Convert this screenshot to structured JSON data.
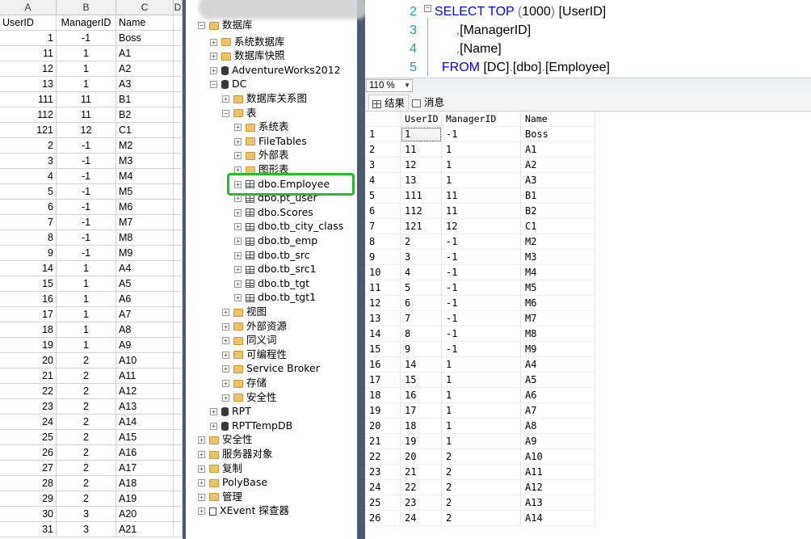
{
  "excel": {
    "col_headers": [
      "A",
      "B",
      "C",
      "D"
    ],
    "header_row": [
      "UserID",
      "ManagerID",
      "Name"
    ],
    "rows": [
      [
        "1",
        "-1",
        "Boss"
      ],
      [
        "11",
        "1",
        "A1"
      ],
      [
        "12",
        "1",
        "A2"
      ],
      [
        "13",
        "1",
        "A3"
      ],
      [
        "111",
        "11",
        "B1"
      ],
      [
        "112",
        "11",
        "B2"
      ],
      [
        "121",
        "12",
        "C1"
      ],
      [
        "2",
        "-1",
        "M2"
      ],
      [
        "3",
        "-1",
        "M3"
      ],
      [
        "4",
        "-1",
        "M4"
      ],
      [
        "5",
        "-1",
        "M5"
      ],
      [
        "6",
        "-1",
        "M6"
      ],
      [
        "7",
        "-1",
        "M7"
      ],
      [
        "8",
        "-1",
        "M8"
      ],
      [
        "9",
        "-1",
        "M9"
      ],
      [
        "14",
        "1",
        "A4"
      ],
      [
        "15",
        "1",
        "A5"
      ],
      [
        "16",
        "1",
        "A6"
      ],
      [
        "17",
        "1",
        "A7"
      ],
      [
        "18",
        "1",
        "A8"
      ],
      [
        "19",
        "1",
        "A9"
      ],
      [
        "20",
        "2",
        "A10"
      ],
      [
        "21",
        "2",
        "A11"
      ],
      [
        "22",
        "2",
        "A12"
      ],
      [
        "23",
        "2",
        "A13"
      ],
      [
        "24",
        "2",
        "A14"
      ],
      [
        "25",
        "2",
        "A15"
      ],
      [
        "26",
        "2",
        "A16"
      ],
      [
        "27",
        "2",
        "A17"
      ],
      [
        "28",
        "2",
        "A18"
      ],
      [
        "29",
        "2",
        "A19"
      ],
      [
        "30",
        "3",
        "A20"
      ],
      [
        "31",
        "3",
        "A21"
      ]
    ]
  },
  "explorer": {
    "nodes": [
      {
        "label": "数据库",
        "icon": "folder",
        "indent": 0,
        "exp": "-",
        "partial": true
      },
      {
        "label": "系统数据库",
        "icon": "folder",
        "indent": 1,
        "exp": "+"
      },
      {
        "label": "数据库快照",
        "icon": "folder",
        "indent": 1,
        "exp": "+"
      },
      {
        "label": "AdventureWorks2012",
        "icon": "db",
        "indent": 1,
        "exp": "+"
      },
      {
        "label": "DC",
        "icon": "db",
        "indent": 1,
        "exp": "-"
      },
      {
        "label": "数据库关系图",
        "icon": "folder",
        "indent": 2,
        "exp": "+"
      },
      {
        "label": "表",
        "icon": "folder",
        "indent": 2,
        "exp": "-"
      },
      {
        "label": "系统表",
        "icon": "folder",
        "indent": 3,
        "exp": "+"
      },
      {
        "label": "FileTables",
        "icon": "folder",
        "indent": 3,
        "exp": "+"
      },
      {
        "label": "外部表",
        "icon": "folder",
        "indent": 3,
        "exp": "+"
      },
      {
        "label": "图形表",
        "icon": "folder",
        "indent": 3,
        "exp": "+"
      },
      {
        "label": "dbo.Employee",
        "icon": "table",
        "indent": 3,
        "exp": "+",
        "highlight": true
      },
      {
        "label": "dbo.pt_user",
        "icon": "table",
        "indent": 3,
        "exp": "+"
      },
      {
        "label": "dbo.Scores",
        "icon": "table",
        "indent": 3,
        "exp": "+"
      },
      {
        "label": "dbo.tb_city_class",
        "icon": "table",
        "indent": 3,
        "exp": "+"
      },
      {
        "label": "dbo.tb_emp",
        "icon": "table",
        "indent": 3,
        "exp": "+"
      },
      {
        "label": "dbo.tb_src",
        "icon": "table",
        "indent": 3,
        "exp": "+"
      },
      {
        "label": "dbo.tb_src1",
        "icon": "table",
        "indent": 3,
        "exp": "+"
      },
      {
        "label": "dbo.tb_tgt",
        "icon": "table",
        "indent": 3,
        "exp": "+"
      },
      {
        "label": "dbo.tb_tgt1",
        "icon": "table",
        "indent": 3,
        "exp": "+"
      },
      {
        "label": "视图",
        "icon": "folder",
        "indent": 2,
        "exp": "+"
      },
      {
        "label": "外部资源",
        "icon": "folder",
        "indent": 2,
        "exp": "+"
      },
      {
        "label": "同义词",
        "icon": "folder",
        "indent": 2,
        "exp": "+"
      },
      {
        "label": "可编程性",
        "icon": "folder",
        "indent": 2,
        "exp": "+"
      },
      {
        "label": "Service Broker",
        "icon": "folder",
        "indent": 2,
        "exp": "+"
      },
      {
        "label": "存储",
        "icon": "folder",
        "indent": 2,
        "exp": "+"
      },
      {
        "label": "安全性",
        "icon": "folder",
        "indent": 2,
        "exp": "+"
      },
      {
        "label": "RPT",
        "icon": "db",
        "indent": 1,
        "exp": "+"
      },
      {
        "label": "RPTTempDB",
        "icon": "db",
        "indent": 1,
        "exp": "+"
      },
      {
        "label": "安全性",
        "icon": "folder",
        "indent": 0,
        "exp": "+"
      },
      {
        "label": "服务器对象",
        "icon": "folder",
        "indent": 0,
        "exp": "+"
      },
      {
        "label": "复制",
        "icon": "folder",
        "indent": 0,
        "exp": "+"
      },
      {
        "label": "PolyBase",
        "icon": "folder",
        "indent": 0,
        "exp": "+"
      },
      {
        "label": "管理",
        "icon": "folder",
        "indent": 0,
        "exp": "+"
      },
      {
        "label": "XEvent 探查器",
        "icon": "xevent",
        "indent": 0,
        "exp": "+"
      }
    ]
  },
  "editor": {
    "lines": [
      {
        "num": "2",
        "parts": [
          {
            "t": "SELECT TOP ",
            "c": "kw"
          },
          {
            "t": "(",
            "c": "gray"
          },
          {
            "t": "1000",
            "c": "blk"
          },
          {
            "t": ") ",
            "c": "gray"
          },
          {
            "t": "[UserID]",
            "c": "blk"
          }
        ]
      },
      {
        "num": "3",
        "parts": [
          {
            "t": "      ,",
            "c": "gray"
          },
          {
            "t": "[ManagerID]",
            "c": "blk"
          }
        ]
      },
      {
        "num": "4",
        "parts": [
          {
            "t": "      ,",
            "c": "gray"
          },
          {
            "t": "[Name]",
            "c": "blk"
          }
        ]
      },
      {
        "num": "5",
        "parts": [
          {
            "t": "  FROM ",
            "c": "kw"
          },
          {
            "t": "[DC]",
            "c": "blk"
          },
          {
            "t": ".",
            "c": "gray"
          },
          {
            "t": "[dbo]",
            "c": "blk"
          },
          {
            "t": ".",
            "c": "gray"
          },
          {
            "t": "[Employee]",
            "c": "blk"
          }
        ]
      }
    ]
  },
  "zoom": {
    "value": "110 %"
  },
  "tabs": {
    "results": "结果",
    "messages": "消息"
  },
  "results": {
    "headers": [
      "UserID",
      "ManagerID",
      "Name"
    ],
    "rows": [
      [
        "1",
        "1",
        "-1",
        "Boss"
      ],
      [
        "2",
        "11",
        "1",
        "A1"
      ],
      [
        "3",
        "12",
        "1",
        "A2"
      ],
      [
        "4",
        "13",
        "1",
        "A3"
      ],
      [
        "5",
        "111",
        "11",
        "B1"
      ],
      [
        "6",
        "112",
        "11",
        "B2"
      ],
      [
        "7",
        "121",
        "12",
        "C1"
      ],
      [
        "8",
        "2",
        "-1",
        "M2"
      ],
      [
        "9",
        "3",
        "-1",
        "M3"
      ],
      [
        "10",
        "4",
        "-1",
        "M4"
      ],
      [
        "11",
        "5",
        "-1",
        "M5"
      ],
      [
        "12",
        "6",
        "-1",
        "M6"
      ],
      [
        "13",
        "7",
        "-1",
        "M7"
      ],
      [
        "14",
        "8",
        "-1",
        "M8"
      ],
      [
        "15",
        "9",
        "-1",
        "M9"
      ],
      [
        "16",
        "14",
        "1",
        "A4"
      ],
      [
        "17",
        "15",
        "1",
        "A5"
      ],
      [
        "18",
        "16",
        "1",
        "A6"
      ],
      [
        "19",
        "17",
        "1",
        "A7"
      ],
      [
        "20",
        "18",
        "1",
        "A8"
      ],
      [
        "21",
        "19",
        "1",
        "A9"
      ],
      [
        "22",
        "20",
        "2",
        "A10"
      ],
      [
        "23",
        "21",
        "2",
        "A11"
      ],
      [
        "24",
        "22",
        "2",
        "A12"
      ],
      [
        "25",
        "23",
        "2",
        "A13"
      ],
      [
        "26",
        "24",
        "2",
        "A14"
      ]
    ]
  }
}
